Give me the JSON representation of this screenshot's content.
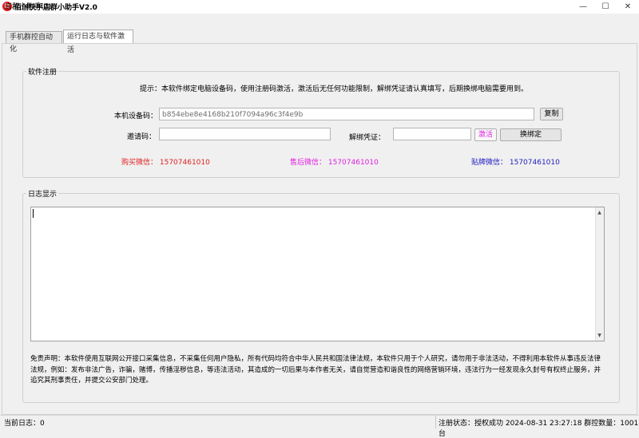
{
  "window": {
    "title": "佰创快手店群小助手V2.0",
    "icon_letter": "D",
    "controls": {
      "minimize": "—",
      "maximize": "☐",
      "close": "✕"
    }
  },
  "menu": {
    "item": "店群小助手(Z)"
  },
  "tabs": [
    {
      "label": "手机群控自动化",
      "active": false
    },
    {
      "label": "运行日志与软件激活",
      "active": true
    }
  ],
  "registration": {
    "group_title": "软件注册",
    "hint": "提示：本软件绑定电脑设备码，使用注册码激活，激活后无任何功能限制，解绑凭证请认真填写，后期换绑电脑需要用到。",
    "device_label": "本机设备码：",
    "device_value": "b854ebe8e4168b210f7094a96c3f4e9b",
    "copy_button": "复制",
    "invite_label": "邀请码：",
    "invite_value": "",
    "unbind_label": "解绑凭证：",
    "unbind_value": "",
    "activate_button": "激活",
    "change_binding_button": "换绑定",
    "contacts": {
      "buy": "购买微信：  15707461010",
      "after_sales": "售后微信：  15707461010",
      "paste": "贴牌微信：  15707461010"
    },
    "colors": {
      "buy": "#e02020",
      "after_sales": "#e020e0",
      "paste": "#2020c0"
    }
  },
  "log": {
    "group_title": "日志显示",
    "content": "",
    "disclaimer": "免责声明：本软件使用互联网公开接口采集信息，不采集任何用户隐私，所有代码均符合中华人民共和国法律法规，本软件只用于个人研究，请勿用于非法活动，不得利用本软件从事违反法律法规，例如：发布非法广告，诈骗，赌博，传播淫秽信息，等违法活动，其造成的一切后果与本作者无关，请自觉营造和谐良性的网络营销环境，违法行为一经发现永久封号有权终止服务，并追究其刑事责任，并提交公安部门处理。"
  },
  "status": {
    "left": "当前日志：0",
    "right": "注册状态：授权成功 2024-08-31 23:27:18 群控数量：1001台"
  }
}
